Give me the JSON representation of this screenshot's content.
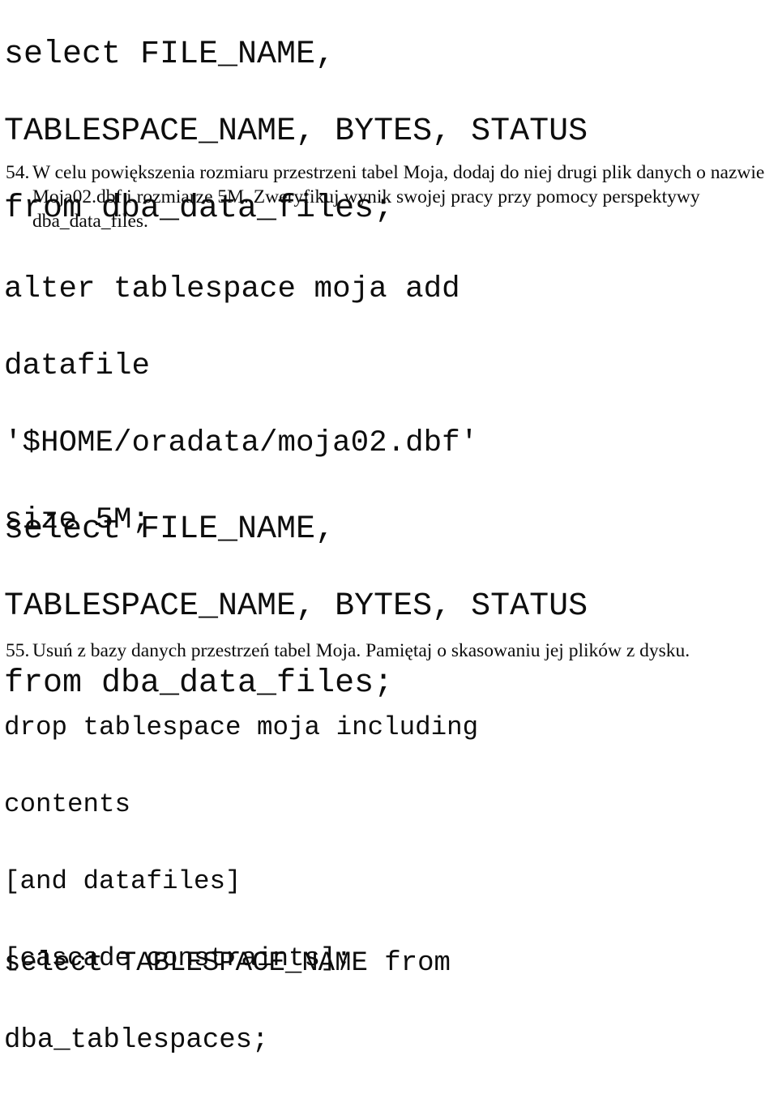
{
  "document": {
    "language": "pl",
    "page_background": "#ffffff",
    "text_color": "#0d0d0d"
  },
  "code_block_1": {
    "name": "select-dba-data-files-query-1",
    "lines": [
      "select FILE_NAME,",
      "TABLESPACE_NAME, BYTES, STATUS",
      "from dba_data_files;"
    ]
  },
  "exercise_54": {
    "number": "54.",
    "text": "W celu powiększenia rozmiaru przestrzeni tabel Moja, dodaj do niej drugi plik danych o nazwie Moja02.dbf i rozmiarze 5M. Zweryfikuj wynik swojej pracy przy pomocy perspektywy dba_data_files."
  },
  "code_block_2": {
    "name": "alter-tablespace-add-datafile",
    "lines": [
      "alter tablespace moja add",
      "datafile",
      "'$HOME/oradata/moja02.dbf'",
      "size 5M;"
    ]
  },
  "code_block_3": {
    "name": "select-dba-data-files-query-2",
    "lines": [
      "select FILE_NAME,",
      "TABLESPACE_NAME, BYTES, STATUS",
      "from dba_data_files;"
    ]
  },
  "exercise_55": {
    "number": "55.",
    "text": "Usuń z bazy danych przestrzeń tabel Moja. Pamiętaj o skasowaniu jej plików z dysku."
  },
  "code_block_4": {
    "name": "drop-tablespace-statement",
    "lines": [
      "drop tablespace moja including",
      "contents",
      "[and datafiles]",
      "[cascade constraints];"
    ]
  },
  "code_block_5": {
    "name": "select-dba-tablespaces-query",
    "lines": [
      "select TABLESPACE_NAME from",
      "dba_tablespaces;"
    ]
  }
}
